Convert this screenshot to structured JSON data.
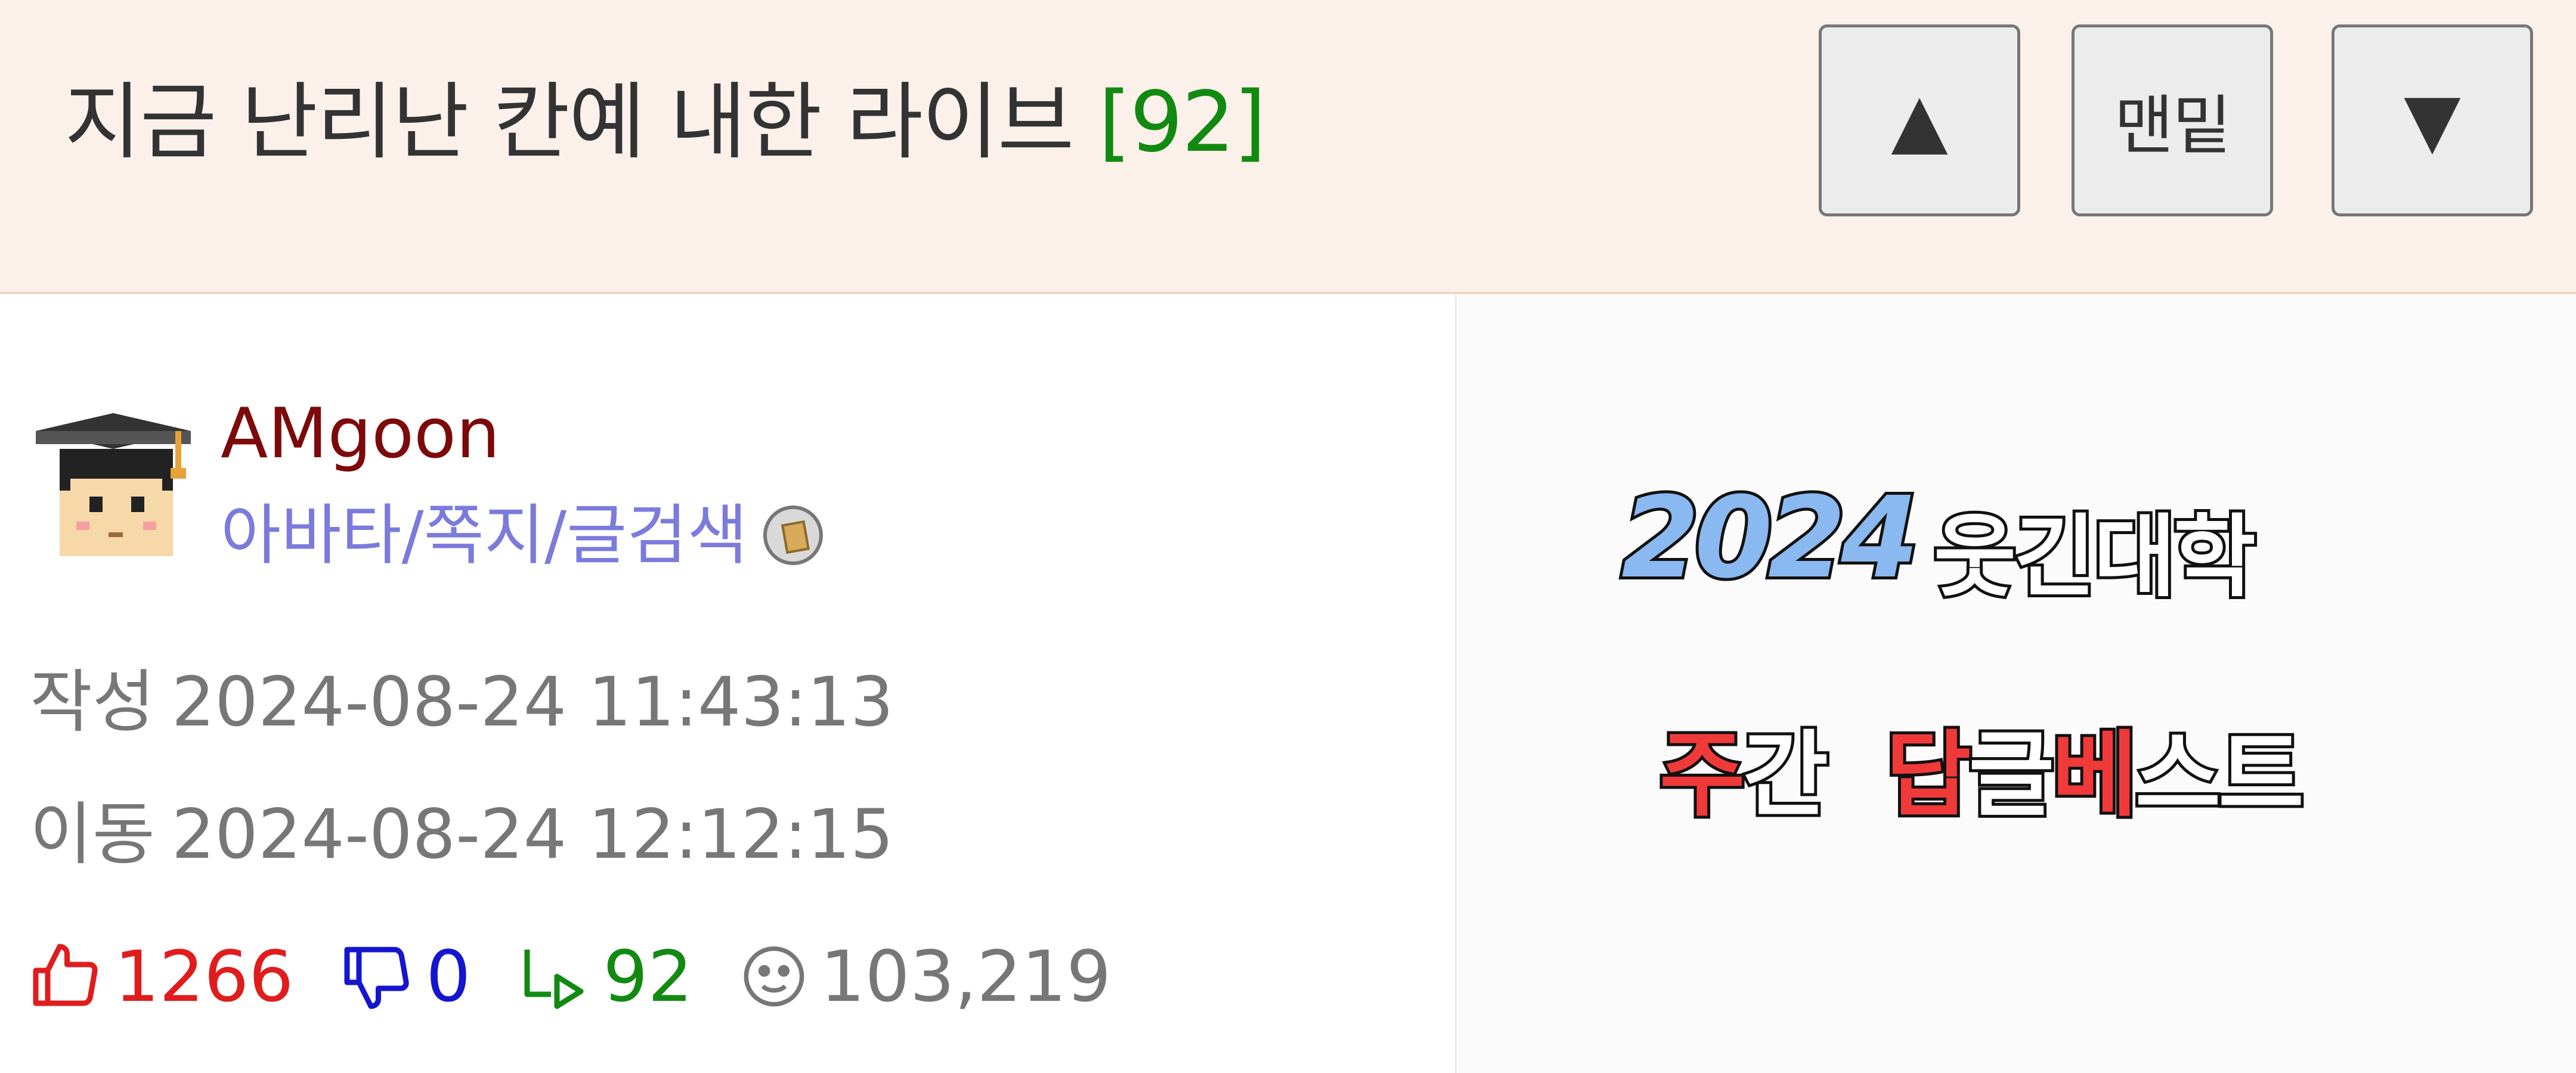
{
  "header": {
    "title": "지금 난리난 칸예 내한 라이브",
    "comment_count": "[92]",
    "buttons": {
      "up_glyph": "▲",
      "bottom_label": "맨밑",
      "down_glyph": "▼"
    }
  },
  "post": {
    "author": {
      "name": "AMgoon",
      "avatar_icon": "graduate-avatar-icon",
      "links": [
        "아바타",
        "쪽지",
        "글검색"
      ],
      "link_separator": "/",
      "badge_icon": "medal-icon"
    },
    "written": {
      "label": "작성",
      "datetime": "2024-08-24 11:43:13"
    },
    "moved": {
      "label": "이동",
      "datetime": "2024-08-24 12:12:15"
    },
    "stats": {
      "likes": "1266",
      "dislikes": "0",
      "replies": "92",
      "views": "103,219"
    }
  },
  "banner": {
    "year": "2024",
    "name": "웃긴대학",
    "line2": [
      "주",
      "간",
      "답",
      "글",
      "베",
      "스",
      "트"
    ]
  },
  "colors": {
    "header_bg": "#fcf1ea",
    "count_green": "#128a12",
    "author_red": "#7c0a0a",
    "link_blue": "#7b7bdc",
    "like_red": "#e01c1c",
    "dislike_blue": "#1515d0"
  }
}
